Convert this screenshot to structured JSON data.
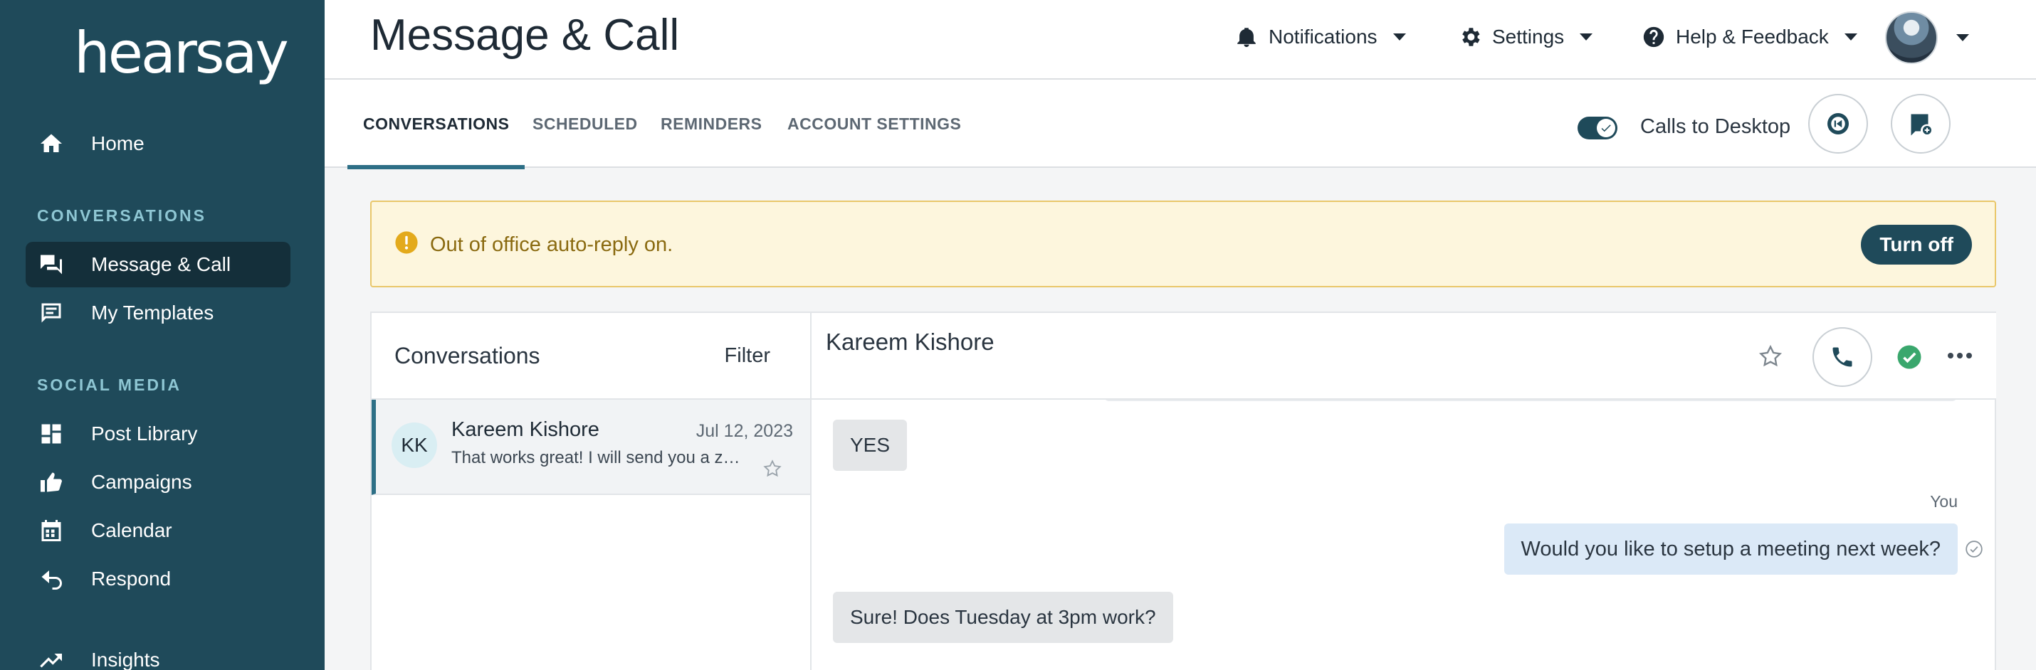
{
  "sidebar": {
    "logo": "hearsay",
    "home": "Home",
    "section_conversations": "CONVERSATIONS",
    "message_call": "Message & Call",
    "my_templates": "My Templates",
    "section_social": "SOCIAL MEDIA",
    "post_library": "Post Library",
    "campaigns": "Campaigns",
    "calendar": "Calendar",
    "respond": "Respond",
    "insights": "Insights"
  },
  "header": {
    "title": "Message & Call",
    "notifications": "Notifications",
    "settings": "Settings",
    "help": "Help & Feedback"
  },
  "tabs": [
    "CONVERSATIONS",
    "SCHEDULED",
    "REMINDERS",
    "ACCOUNT SETTINGS"
  ],
  "calls_toggle": {
    "label": "Calls to Desktop",
    "on": true
  },
  "banner": {
    "text": "Out of office auto-reply on.",
    "button": "Turn off"
  },
  "conversations": {
    "title": "Conversations",
    "filter": "Filter",
    "items": [
      {
        "initials": "KK",
        "name": "Kareem Kishore",
        "date": "Jul 12, 2023",
        "snippet": "That works great! I will send you a zo..."
      }
    ]
  },
  "thread": {
    "contact": "Kareem Kishore",
    "messages": [
      {
        "from": "contact",
        "text": "YES"
      },
      {
        "from": "you",
        "sender_label": "You",
        "text": "Would you like to setup a meeting next week?"
      },
      {
        "from": "contact",
        "text": "Sure! Does Tuesday at 3pm work?"
      }
    ]
  },
  "colors": {
    "sidebar_bg": "#1f4a5a",
    "sidebar_active": "#142f3a",
    "accent": "#2d6f86",
    "banner_bg": "#fdf6dd",
    "banner_border": "#e9c76a",
    "check_green": "#3aa76d"
  }
}
